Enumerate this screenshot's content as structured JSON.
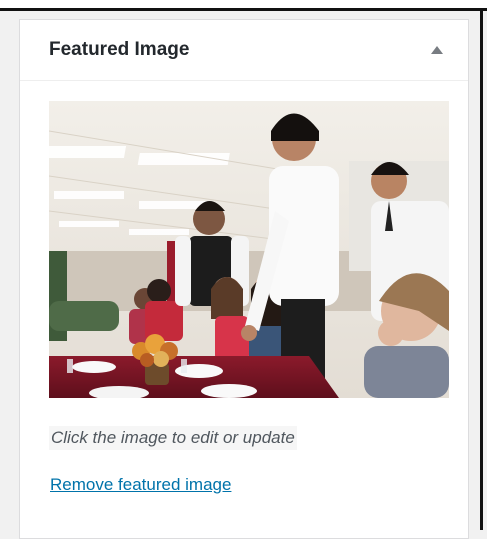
{
  "metabox": {
    "title": "Featured Image",
    "toggle_icon": "triangle-up-icon",
    "hint": "Click the image to edit or update",
    "remove_link": "Remove featured image"
  },
  "colors": {
    "link": "#0073aa",
    "title": "#23282d",
    "hint": "#50575e",
    "border": "#dcdcde"
  }
}
